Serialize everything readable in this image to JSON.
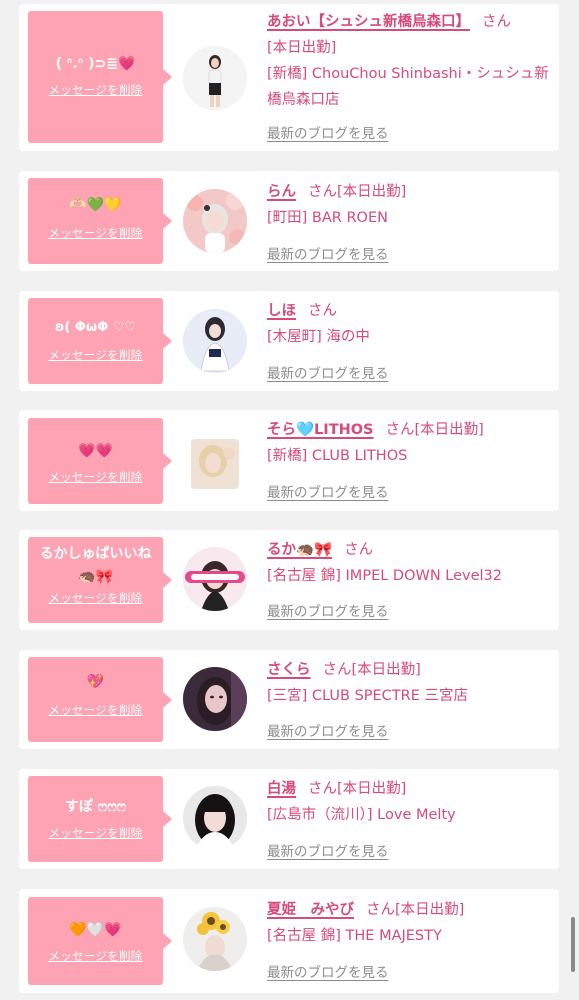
{
  "delete_label": "メッセージを削除",
  "san_label": "さん",
  "today_label": "[本日出勤]",
  "blog_label": "最新のブログを見る",
  "entries": [
    {
      "message": "( ᐢ.ᐢ )⊃≣💗",
      "message2": "",
      "name": "あおい【シュシュ新橋烏森口】",
      "today": "",
      "shop": "[新橋] ChouChou Shinbashi・シュシュ新橋烏森口店",
      "line2_today": "[本日出勤]",
      "avatar_icon": "girl-standing-photo"
    },
    {
      "message": "🫶🏻💚💛",
      "message2": "",
      "name": "らん",
      "today": "[本日出勤]",
      "shop": "[町田] BAR ROEN",
      "line2_today": "",
      "avatar_icon": "girl-floral-photo"
    },
    {
      "message": "ʚ( ΦωΦ ♡♡",
      "message2": "",
      "name": "しほ",
      "today": "",
      "shop": "[木屋町] 海の中",
      "line2_today": "",
      "avatar_icon": "girl-sitting-photo"
    },
    {
      "message": "💗💗",
      "message2": "",
      "name": "そら🩵LITHOS",
      "today": "[本日出勤]",
      "shop": "[新橋] CLUB LITHOS",
      "line2_today": "",
      "avatar_icon": "girl-blonde-photo"
    },
    {
      "message": "るかしゅぱいいね",
      "message2": "🦔🎀",
      "name": "るか🦔🎀",
      "today": "",
      "shop": "[名古屋 錦] IMPEL DOWN Level32",
      "line2_today": "",
      "avatar_icon": "girl-sticker-photo"
    },
    {
      "message": "💖",
      "message2": "",
      "name": "さくら",
      "today": "[本日出勤]",
      "shop": "[三宮] CLUB SPECTRE 三宮店",
      "line2_today": "",
      "avatar_icon": "girl-portrait-photo"
    },
    {
      "message": "すぽ ෆෆෆ",
      "message2": "",
      "name": "白湯",
      "today": "[本日出勤]",
      "shop": "[広島市（流川）] Love Melty",
      "line2_today": "",
      "avatar_icon": "girl-dark-hair-photo"
    },
    {
      "message": "🧡🤍💗",
      "message2": "",
      "name": "夏姫　みやび",
      "today": "[本日出勤]",
      "shop": "[名古屋 錦] THE MAJESTY",
      "line2_today": "",
      "avatar_icon": "girl-sunflower-photo"
    }
  ],
  "colors": {
    "accent_pink": "#fea3b4",
    "name_pink": "#d74b7a",
    "link_gray": "#8d8d8d",
    "background": "#f1f1f1"
  }
}
